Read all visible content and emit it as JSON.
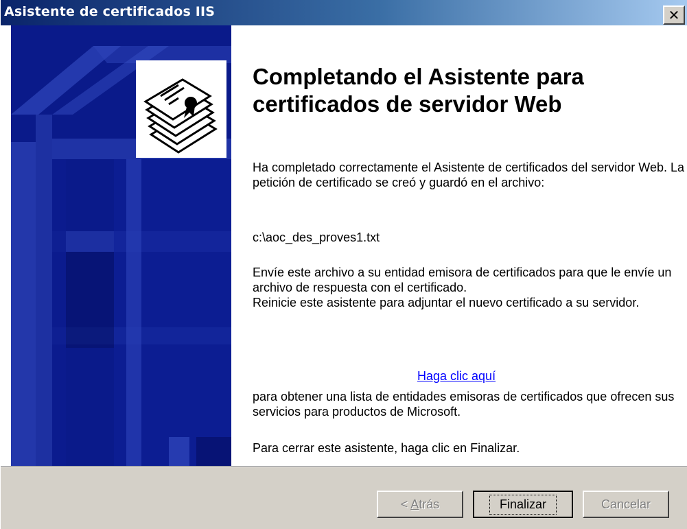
{
  "window": {
    "title": "Asistente de certificados IIS",
    "close_glyph": "✕"
  },
  "main": {
    "heading": "Completando el Asistente para certificados de servidor Web",
    "para1": "Ha completado correctamente el Asistente de certificados del servidor Web. La petición de certificado se creó y guardó en el archivo:",
    "file_path": "c:\\aoc_des_proves1.txt",
    "para2": "Envíe este archivo a su entidad emisora de certificados para que le envíe un archivo de respuesta con el certificado.",
    "para3": "Reinicie este asistente para adjuntar el nuevo certificado a su servidor.",
    "link_text": "Haga clic aquí",
    "para4": "para obtener una lista de entidades emisoras de certificados que ofrecen sus servicios para productos de Microsoft.",
    "para5": "Para cerrar este asistente, haga clic en Finalizar."
  },
  "buttons": {
    "back_prefix": "< ",
    "back_mnemonic": "A",
    "back_rest": "trás",
    "finish": "Finalizar",
    "cancel": "Cancelar"
  },
  "icons": {
    "wizard": "certificate-stack-icon",
    "close": "close-icon"
  },
  "colors": {
    "title_gradient_start": "#0a246a",
    "title_gradient_end": "#a6caf0",
    "banner": "#0a1a8a",
    "link": "#0000ff",
    "face": "#d4d0c8"
  }
}
